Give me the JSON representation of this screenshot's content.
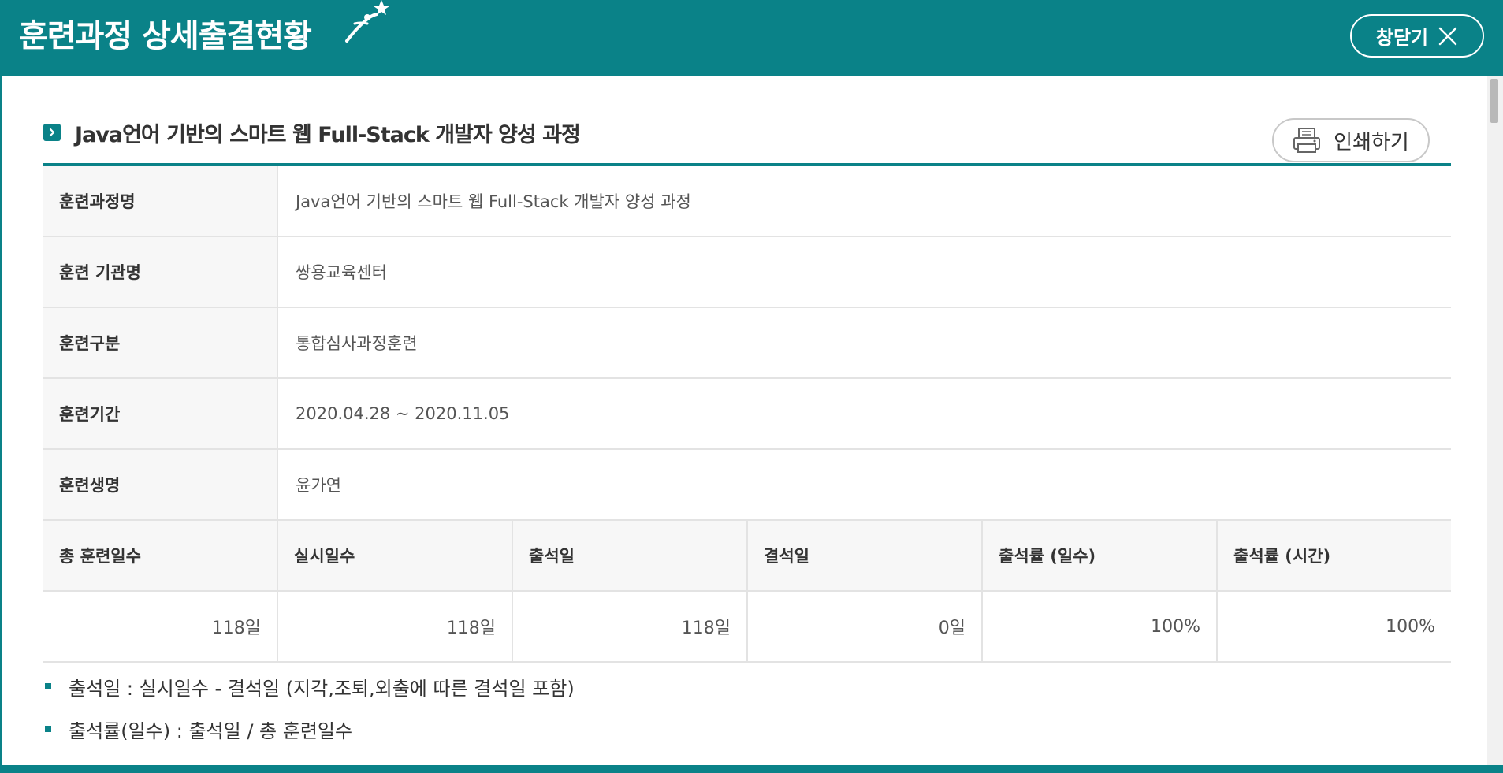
{
  "window": {
    "title": "훈련과정 상세출결현황",
    "close_label": "창닫기"
  },
  "course": {
    "heading": "Java언어 기반의 스마트 웹 Full-Stack 개발자 양성 과정",
    "print_label": "인쇄하기"
  },
  "info_rows": [
    {
      "label": "훈련과정명",
      "value": "Java언어 기반의 스마트 웹 Full-Stack 개발자 양성 과정"
    },
    {
      "label": "훈련 기관명",
      "value": "쌍용교육센터"
    },
    {
      "label": "훈련구분",
      "value": "통합심사과정훈련"
    },
    {
      "label": "훈련기간",
      "value": "2020.04.28 ~ 2020.11.05"
    },
    {
      "label": "훈련생명",
      "value": "윤가연"
    }
  ],
  "stats": {
    "headers": [
      "총 훈련일수",
      "실시일수",
      "출석일",
      "결석일",
      "출석률 (일수)",
      "출석률 (시간)"
    ],
    "values": [
      "118일",
      "118일",
      "118일",
      "0일",
      "100%",
      "100%"
    ]
  },
  "notes": [
    "출석일 : 실시일수 - 결석일 (지각,조퇴,외출에 따른 결석일 포함)",
    "출석률(일수) : 출석일 / 총 훈련일수"
  ],
  "colors": {
    "accent": "#0a8288",
    "label_bg": "#f7f7f7",
    "border": "#e3e3e3"
  },
  "icons": {
    "decoration": "star-figure-icon",
    "close": "close-x-icon",
    "heading": "chevron-right-icon",
    "print": "printer-icon"
  }
}
